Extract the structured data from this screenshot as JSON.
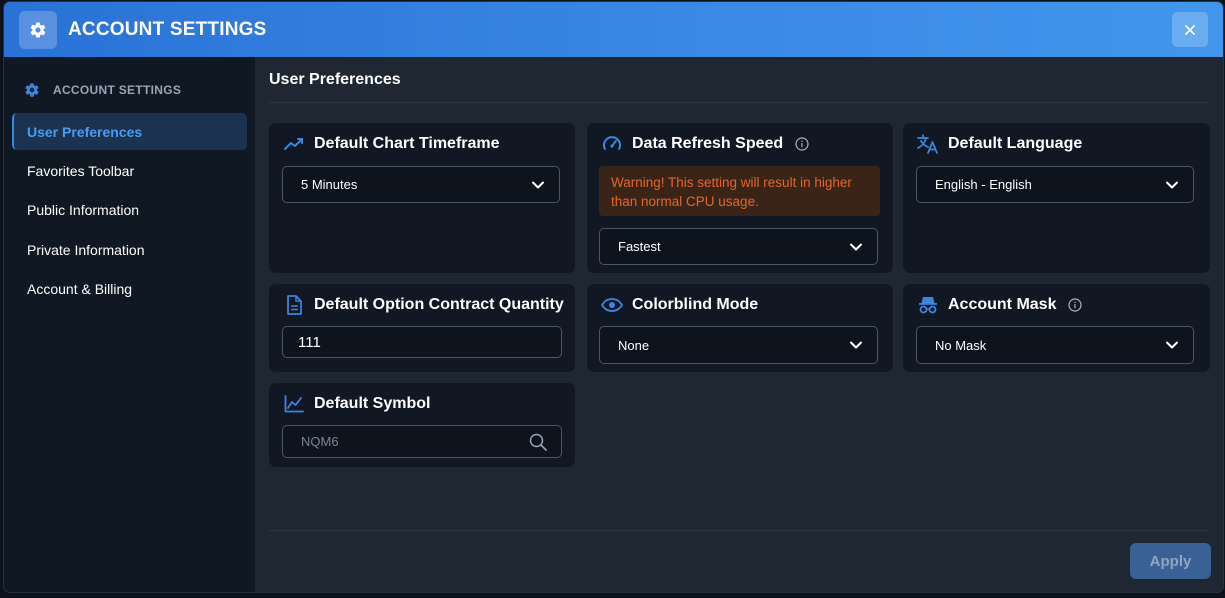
{
  "header": {
    "title": "ACCOUNT SETTINGS",
    "icon": "gear-icon",
    "close_icon": "close-icon"
  },
  "sidebar": {
    "heading": "ACCOUNT SETTINGS",
    "heading_icon": "gear-icon",
    "items": [
      {
        "label": "User Preferences",
        "active": true
      },
      {
        "label": "Favorites Toolbar",
        "active": false
      },
      {
        "label": "Public Information",
        "active": false
      },
      {
        "label": "Private Information",
        "active": false
      },
      {
        "label": "Account & Billing",
        "active": false
      }
    ]
  },
  "main": {
    "title": "User Preferences",
    "cards": {
      "chart_timeframe": {
        "title": "Default Chart Timeframe",
        "icon": "trending-up-icon",
        "value": "5 Minutes"
      },
      "refresh_speed": {
        "title": "Data Refresh Speed",
        "icon": "speedometer-icon",
        "warning": "Warning! This setting will result in higher than normal CPU usage.",
        "value": "Fastest"
      },
      "language": {
        "title": "Default Language",
        "icon": "translate-icon",
        "value": "English - English"
      },
      "option_quantity": {
        "title": "Default Option Contract Quantity",
        "icon": "document-icon",
        "value": "111"
      },
      "colorblind": {
        "title": "Colorblind Mode",
        "icon": "eye-icon",
        "value": "None"
      },
      "account_mask": {
        "title": "Account Mask",
        "icon": "incognito-icon",
        "value": "No Mask"
      },
      "symbol": {
        "title": "Default Symbol",
        "icon": "line-chart-icon",
        "placeholder": "NQM6"
      }
    },
    "apply_label": "Apply"
  },
  "colors": {
    "accent": "#3b86e0",
    "header_gradient_start": "#2a72d6",
    "warning_text": "#e4662e",
    "card_bg": "#111824"
  }
}
